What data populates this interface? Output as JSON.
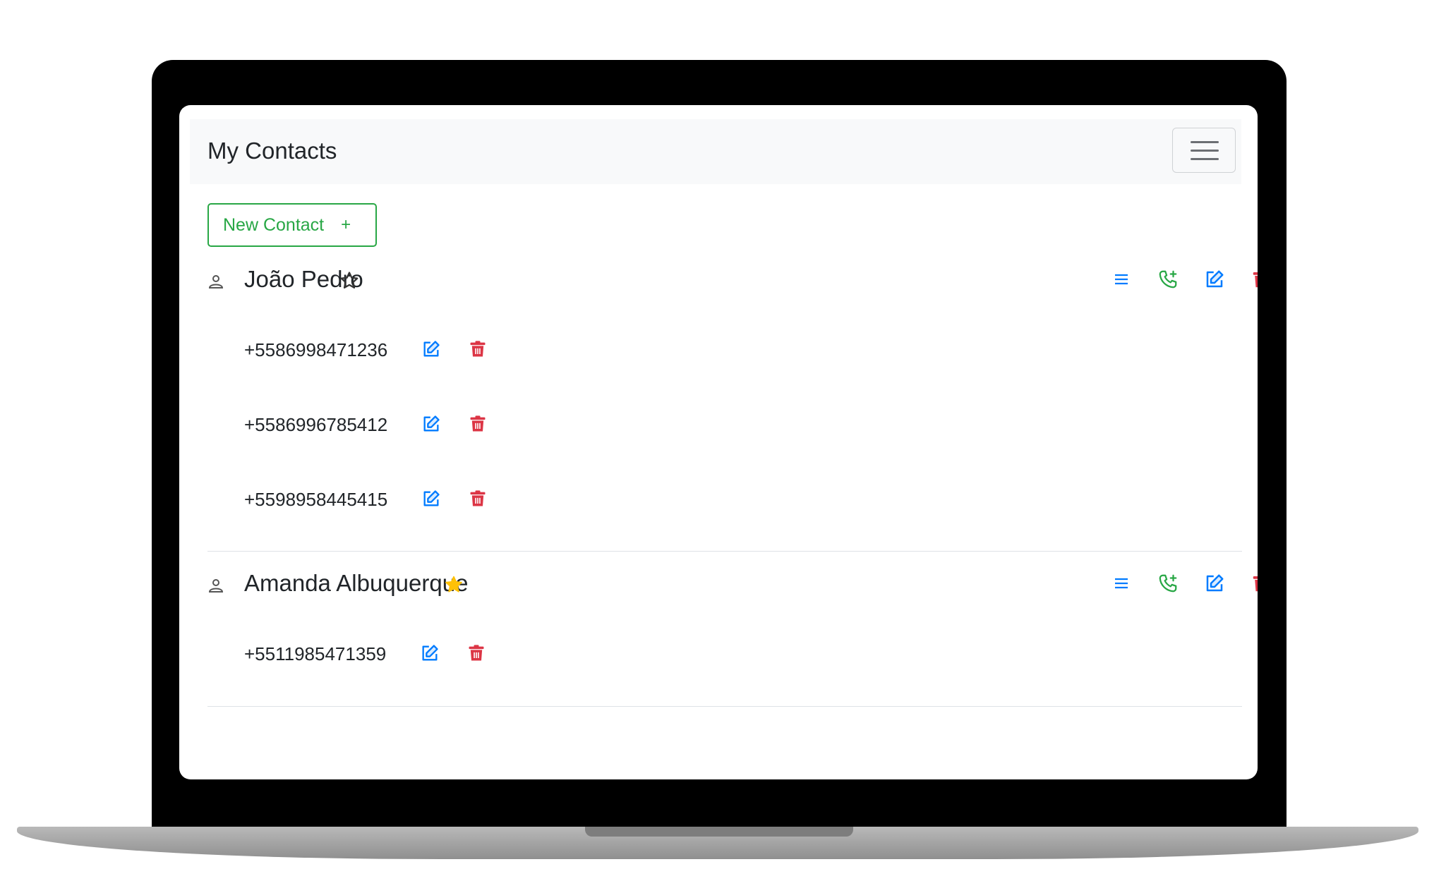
{
  "app": {
    "title": "My Contacts"
  },
  "toolbar": {
    "new_contact_label": "New Contact",
    "new_contact_icon": "+"
  },
  "colors": {
    "primary": "#007bff",
    "success": "#28a745",
    "danger": "#dc3545",
    "warning": "#ffc107"
  },
  "contacts": [
    {
      "name": "João Pedro",
      "favorite": false,
      "phones": [
        "+5586998471236",
        "+5586996785412",
        "+5598958445415"
      ]
    },
    {
      "name": "Amanda Albuquerque",
      "favorite": true,
      "phones": [
        "+5511985471359"
      ]
    }
  ],
  "icons": {
    "person": "person-icon",
    "star_empty": "star-outline-icon",
    "star_filled": "star-filled-icon",
    "list": "list-icon",
    "add_phone": "phone-plus-icon",
    "edit": "edit-icon",
    "delete": "trash-icon",
    "menu": "hamburger-menu-icon"
  }
}
